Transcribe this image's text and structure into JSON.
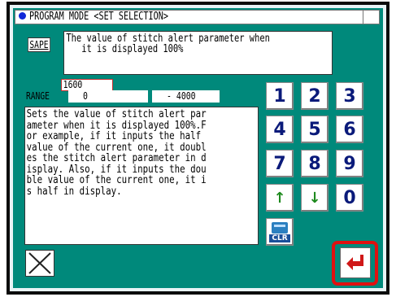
{
  "title": "PROGRAM MODE <SET SELECTION>",
  "param": {
    "code": "SAPE",
    "description": "The value of stitch alert parameter when\n   it is displayed 100%"
  },
  "value": "1600",
  "range": {
    "label": "RANGE",
    "min": "0",
    "max": "- 4000"
  },
  "help_text": "Sets the value of stitch alert par\nameter when it is displayed 100%.F\nor example, if it inputs the half\nvalue of the current one, it doubl\nes the stitch alert parameter in d\nisplay. Also, if it inputs the dou\nble value of the current one, it i\ns half in display.",
  "keypad": {
    "k1": "1",
    "k2": "2",
    "k3": "3",
    "k4": "4",
    "k5": "5",
    "k6": "6",
    "k7": "7",
    "k8": "8",
    "k9": "9",
    "k0": "0",
    "up": "↑",
    "down": "↓",
    "clr": "CLR"
  },
  "icons": {
    "cancel": "close-x-icon",
    "enter": "enter-return-icon",
    "clear": "clear-icon"
  },
  "colors": {
    "screen": "#00897b",
    "key_text": "#0a1a7a",
    "arrow": "#1e8a1e",
    "highlight": "#e01010",
    "enter_arrow": "#d01818"
  }
}
